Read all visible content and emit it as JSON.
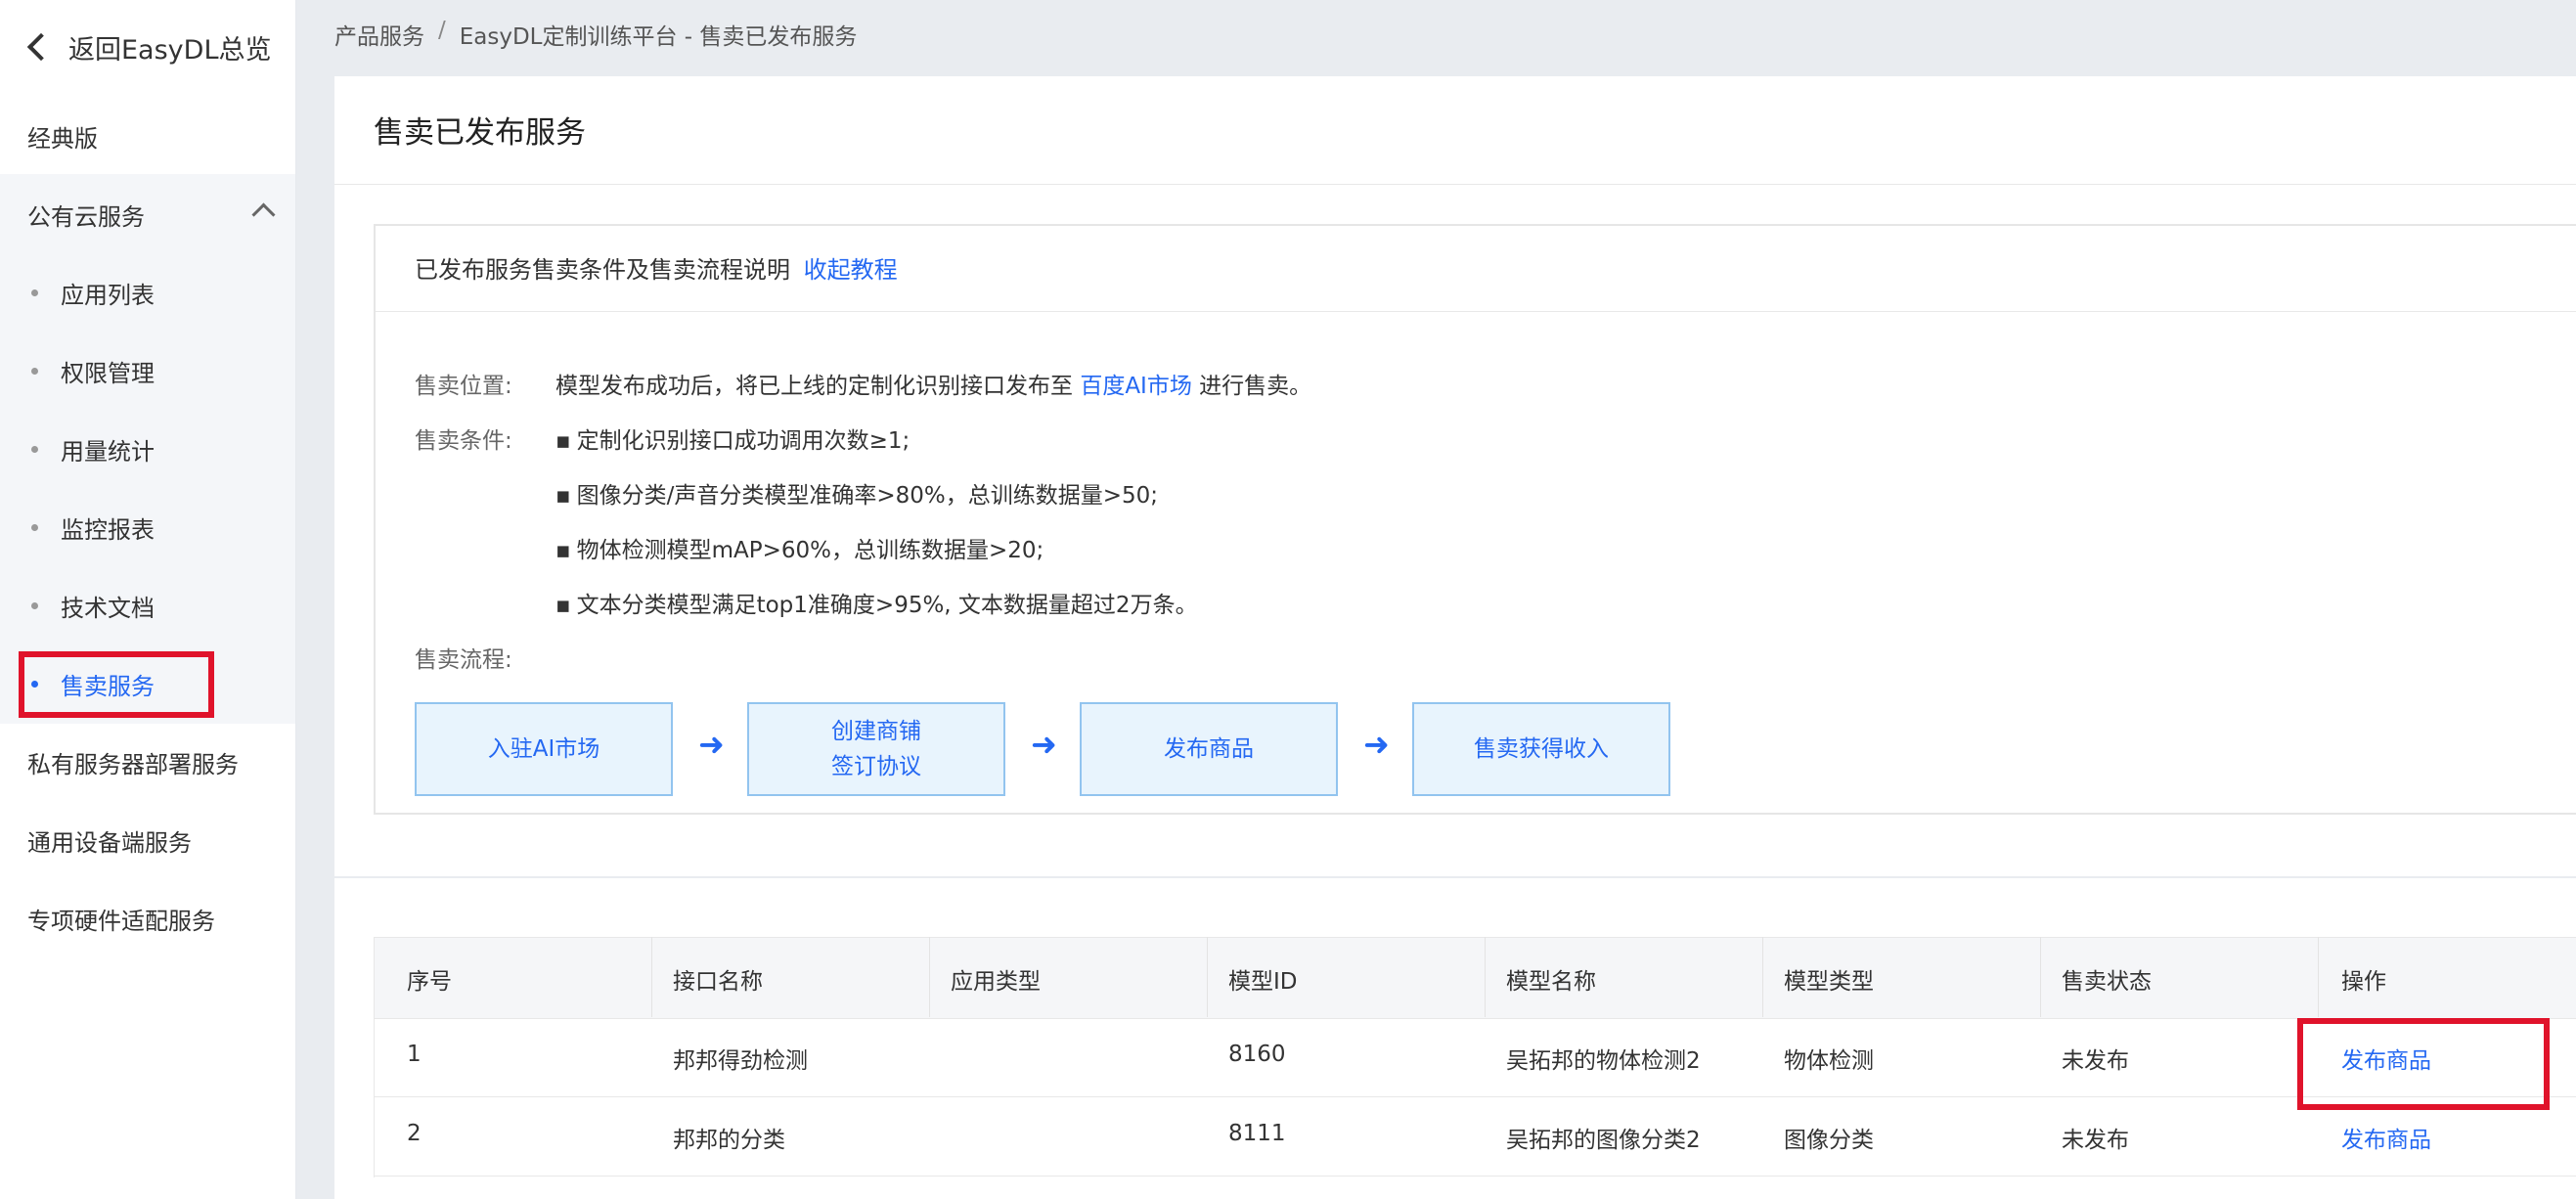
{
  "sidebar": {
    "back_label": "返回EasyDL总览",
    "classic": "经典版",
    "public_cloud": {
      "label": "公有云服务",
      "items": [
        "应用列表",
        "权限管理",
        "用量统计",
        "监控报表",
        "技术文档",
        "售卖服务"
      ]
    },
    "private_server": "私有服务器部署服务",
    "general_device": "通用设备端服务",
    "hardware": "专项硬件适配服务"
  },
  "breadcrumb": {
    "root": "产品服务",
    "separator": "/",
    "current": "EasyDL定制训练平台 - 售卖已发布服务"
  },
  "page": {
    "title": "售卖已发布服务"
  },
  "info": {
    "header_text": "已发布服务售卖条件及售卖流程说明",
    "collapse_link": "收起教程",
    "location_label": "售卖位置:",
    "location_text_pre": "模型发布成功后，将已上线的定制化识别接口发布至",
    "location_link": "百度AI市场",
    "location_text_post": "进行售卖。",
    "conditions_label": "售卖条件:",
    "conditions": [
      "定制化识别接口成功调用次数≥1;",
      "图像分类/声音分类模型准确率>80%，总训练数据量>50;",
      "物体检测模型mAP>60%，总训练数据量>20;",
      "文本分类模型满足top1准确度>95%, 文本数据量超过2万条。"
    ],
    "flow_label": "售卖流程:",
    "flow_steps": [
      {
        "line1": "入驻AI市场",
        "line2": ""
      },
      {
        "line1": "创建商铺",
        "line2": "签订协议"
      },
      {
        "line1": "发布商品",
        "line2": ""
      },
      {
        "line1": "售卖获得收入",
        "line2": ""
      }
    ],
    "arrow": "➜"
  },
  "table": {
    "headers": [
      "序号",
      "接口名称",
      "应用类型",
      "模型ID",
      "模型名称",
      "模型类型",
      "售卖状态",
      "操作"
    ],
    "rows": [
      {
        "index": "1",
        "api_name": "邦邦得劲检测",
        "app_type": "",
        "model_id": "8160",
        "model_name": "吴拓邦的物体检测2",
        "model_type": "物体检测",
        "status": "未发布",
        "action": "发布商品"
      },
      {
        "index": "2",
        "api_name": "邦邦的分类",
        "app_type": "",
        "model_id": "8111",
        "model_name": "吴拓邦的图像分类2",
        "model_type": "图像分类",
        "status": "未发布",
        "action": "发布商品"
      }
    ]
  },
  "colors": {
    "accent": "#2468f2",
    "highlight": "#e0132b"
  }
}
